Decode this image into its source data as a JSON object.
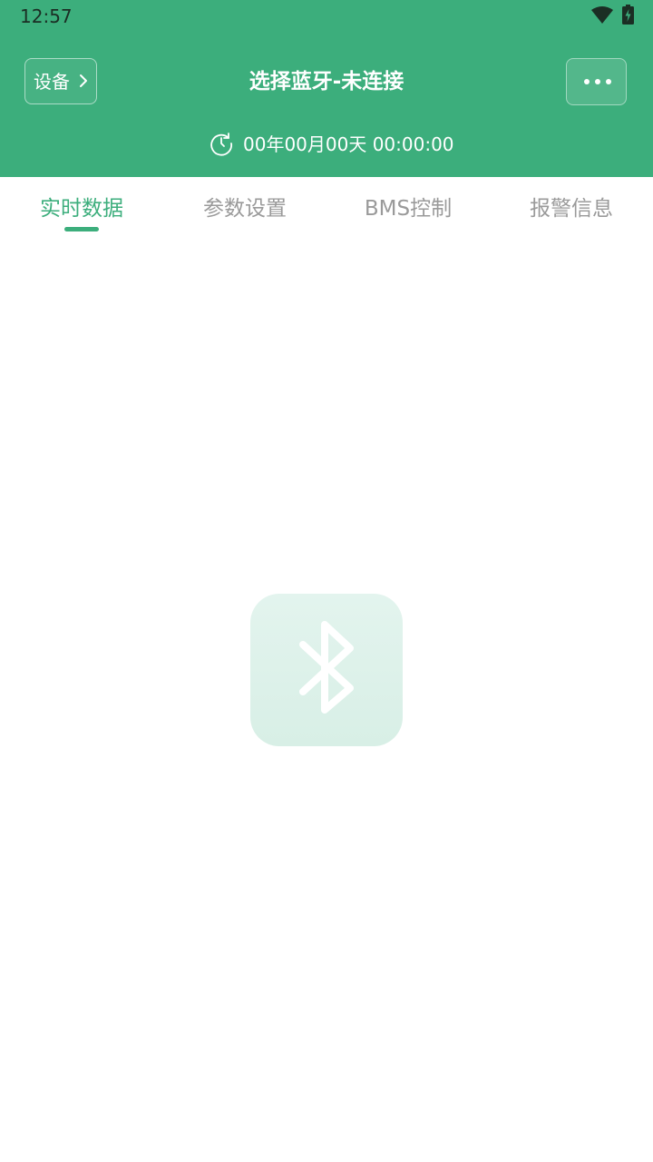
{
  "status_bar": {
    "time": "12:57"
  },
  "header": {
    "device_button_label": "设备",
    "title": "选择蓝牙-未连接",
    "datetime": "00年00月00天 00:00:00"
  },
  "tabs": [
    {
      "label": "实时数据",
      "active": true
    },
    {
      "label": "参数设置",
      "active": false
    },
    {
      "label": "BMS控制",
      "active": false
    },
    {
      "label": "报警信息",
      "active": false
    }
  ],
  "empty_state": {
    "icon": "bluetooth-icon"
  },
  "colors": {
    "primary": "#3cae7c",
    "tab_inactive": "#9a9a9a",
    "tile_background": "#e0f3ec"
  }
}
